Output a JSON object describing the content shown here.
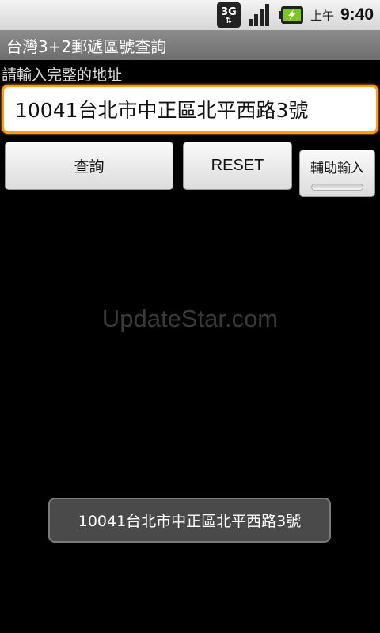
{
  "status_bar": {
    "network_label": "3G",
    "network_arrows": "⇅",
    "ampm": "上午",
    "time": "9:40",
    "battery_color": "#7ec623"
  },
  "app": {
    "title": "台灣3+2郵遞區號查詢"
  },
  "form": {
    "prompt": "請輸入完整的地址",
    "address_value": "10041台北市中正區北平西路3號"
  },
  "buttons": {
    "query_label": "查詢",
    "reset_label": "RESET",
    "assist_label": "輔助輸入",
    "assist_toggle": false
  },
  "watermark": "UpdateStar.com",
  "toast": {
    "message": "10041台北市中正區北平西路3號"
  },
  "colors": {
    "focus_accent": "#ff9a1a",
    "background": "#000000"
  }
}
